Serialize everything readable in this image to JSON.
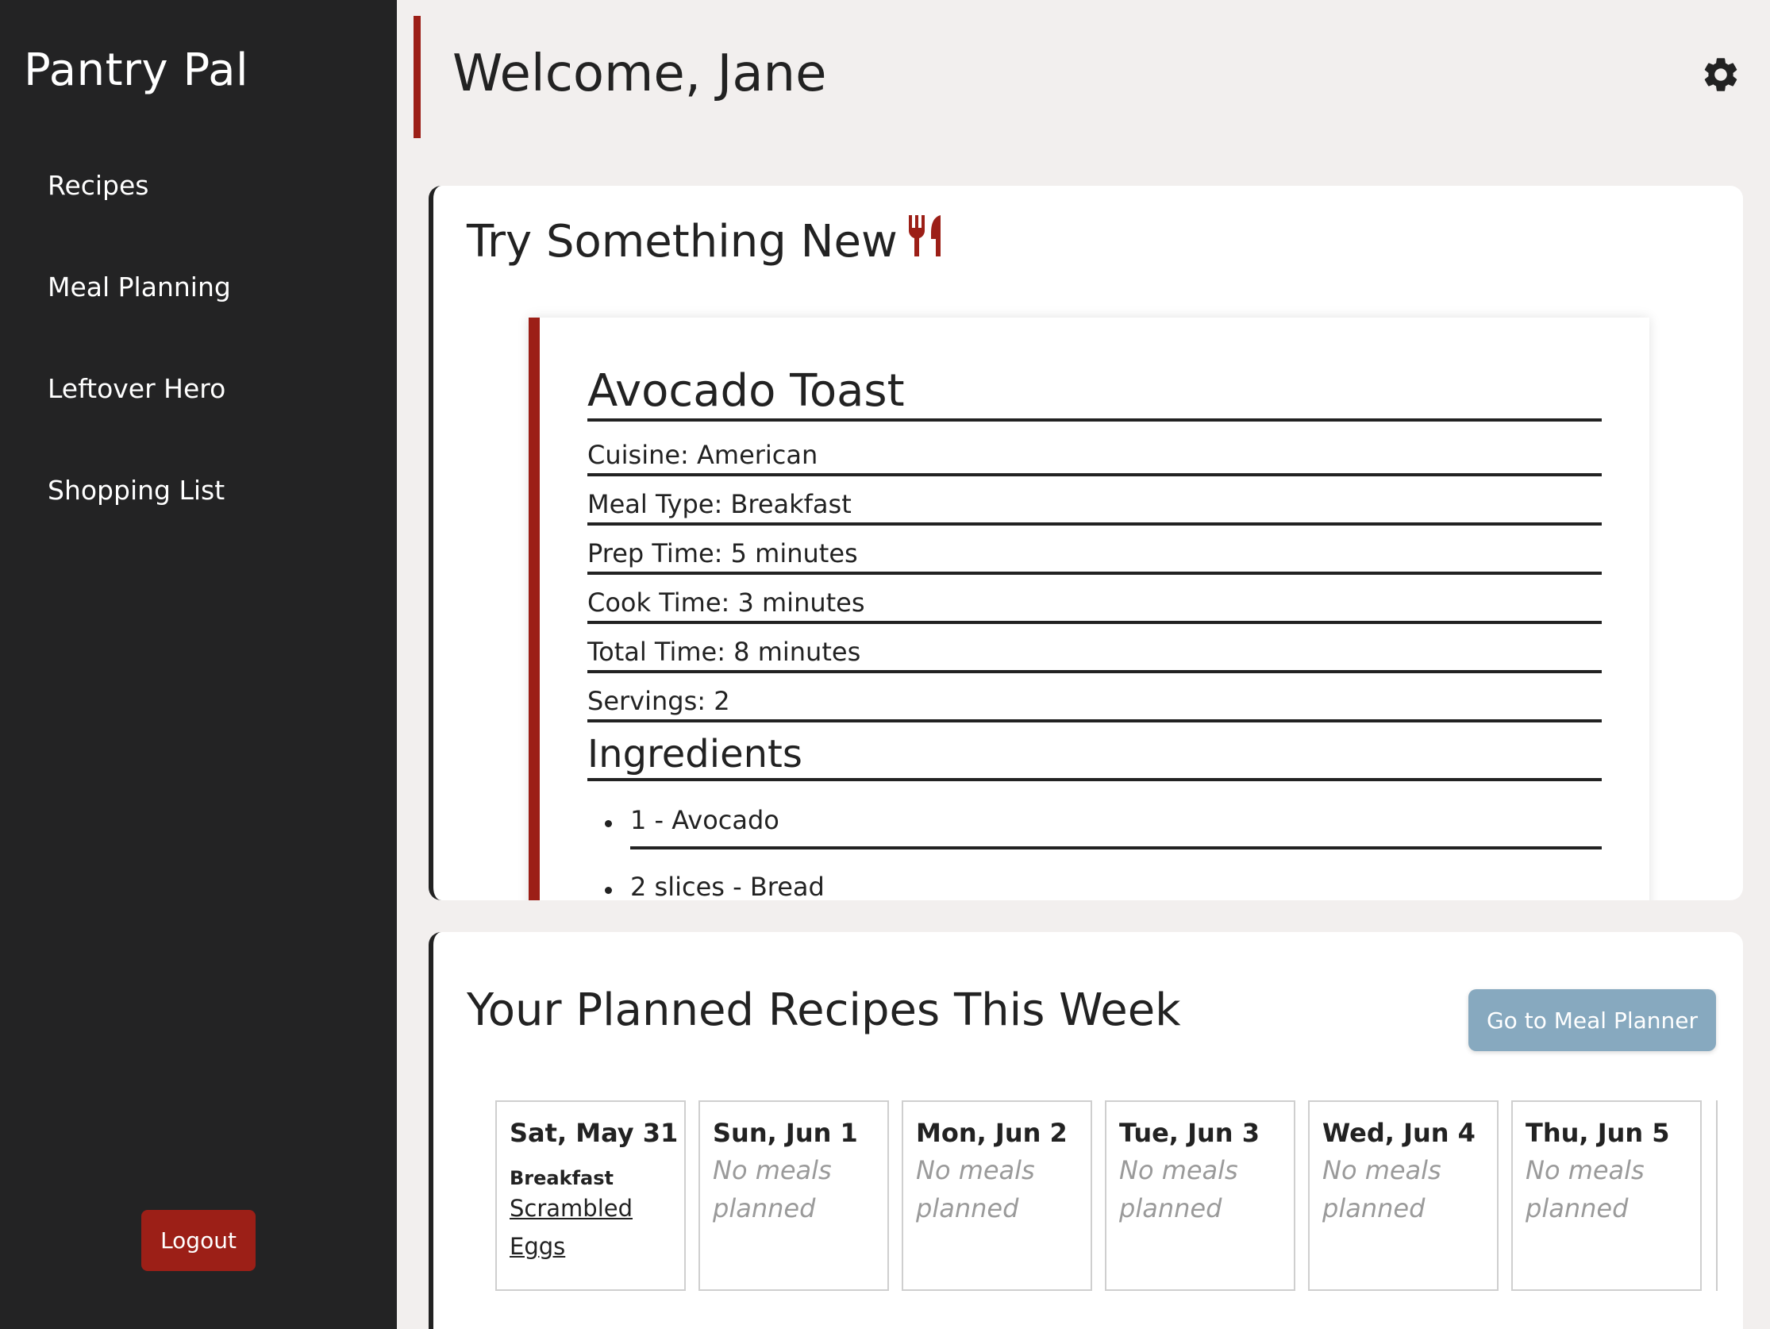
{
  "sidebar": {
    "brand": "Pantry Pal",
    "nav": [
      {
        "label": "Recipes"
      },
      {
        "label": "Meal Planning"
      },
      {
        "label": "Leftover Hero"
      },
      {
        "label": "Shopping List"
      }
    ],
    "logout_label": "Logout"
  },
  "header": {
    "welcome": "Welcome, Jane",
    "settings_icon": "gear-icon"
  },
  "try_new": {
    "title": "Try Something New",
    "icon": "fork-knife-icon",
    "recipe": {
      "name": "Avocado Toast",
      "cuisine": "Cuisine: American",
      "meal_type": "Meal Type: Breakfast",
      "prep_time": "Prep Time: 5 minutes",
      "cook_time": "Cook Time: 3 minutes",
      "total_time": "Total Time: 8 minutes",
      "servings": "Servings: 2",
      "ingredients_heading": "Ingredients",
      "ingredients": [
        "1 - Avocado",
        "2 slices - Bread"
      ]
    }
  },
  "planned": {
    "title": "Your Planned Recipes This Week",
    "button_label": "Go to Meal Planner",
    "days": [
      {
        "label": "Sat, May 31",
        "meal_type": "Breakfast",
        "meal_line1": "Scrambled",
        "meal_line2": "Eggs"
      },
      {
        "label": "Sun, Jun 1",
        "empty_line1": "No meals",
        "empty_line2": "planned"
      },
      {
        "label": "Mon, Jun 2",
        "empty_line1": "No meals",
        "empty_line2": "planned"
      },
      {
        "label": "Tue, Jun 3",
        "empty_line1": "No meals",
        "empty_line2": "planned"
      },
      {
        "label": "Wed, Jun 4",
        "empty_line1": "No meals",
        "empty_line2": "planned"
      },
      {
        "label": "Thu, Jun 5",
        "empty_line1": "No meals",
        "empty_line2": "planned"
      }
    ]
  },
  "colors": {
    "sidebar_bg": "#232324",
    "accent_red": "#9c1f17",
    "button_blue": "#87a9bf",
    "page_bg": "#f2efee"
  }
}
